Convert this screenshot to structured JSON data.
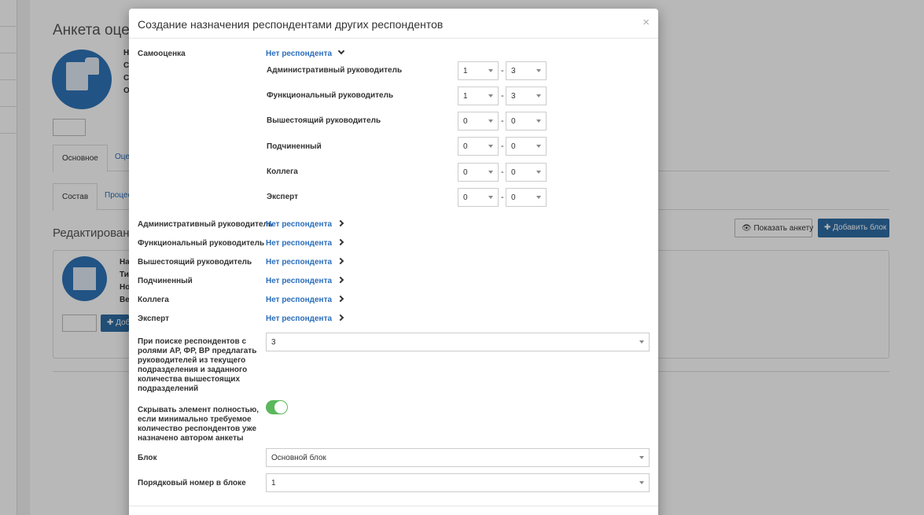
{
  "background": {
    "title": "Анкета оцен",
    "avatar_letters": [
      "Н",
      "С",
      "С",
      "О"
    ],
    "tabs": [
      "Основное",
      "Оце"
    ],
    "subtabs": [
      "Состав",
      "Процес"
    ],
    "section_heading": "Редактирование",
    "show_button": "Показать анкету",
    "add_block_button": "Добавить блок",
    "panel_letters": [
      "На",
      "Ти",
      "Но",
      "Ве"
    ],
    "panel_add": "Доб"
  },
  "modal": {
    "title": "Создание назначения респондентами других респондентов",
    "close": "×",
    "self": {
      "label": "Самооценка",
      "link": "Нет респондента",
      "roles": [
        {
          "label": "Административный руководитель",
          "from": "1",
          "to": "3"
        },
        {
          "label": "Функциональный руководитель",
          "from": "1",
          "to": "3"
        },
        {
          "label": "Вышестоящий руководитель",
          "from": "0",
          "to": "0"
        },
        {
          "label": "Подчиненный",
          "from": "0",
          "to": "0"
        },
        {
          "label": "Коллега",
          "from": "0",
          "to": "0"
        },
        {
          "label": "Эксперт",
          "from": "0",
          "to": "0"
        }
      ],
      "dash": "-"
    },
    "respondents": [
      {
        "label": "Административный руководитель",
        "link": "Нет респондента"
      },
      {
        "label": "Функциональный руководитель",
        "link": "Нет респондента"
      },
      {
        "label": "Вышестоящий руководитель",
        "link": "Нет респондента"
      },
      {
        "label": "Подчиненный",
        "link": "Нет респондента"
      },
      {
        "label": "Коллега",
        "link": "Нет респондента"
      },
      {
        "label": "Эксперт",
        "link": "Нет респондента"
      }
    ],
    "search_label": "При поиске респондентов с ролями АР, ФР, ВР предлагать руководителей из текущего подразделения и заданного количества вышестоящих подразделений",
    "search_value": "3",
    "hide_label": "Скрывать элемент полностью, если минимально требуемое количество респондентов уже  назначено автором анкеты",
    "hide_toggle_on": true,
    "block_label": "Блок",
    "block_value": "Основной блок",
    "order_label": "Порядковый номер в блоке",
    "order_value": "1"
  }
}
